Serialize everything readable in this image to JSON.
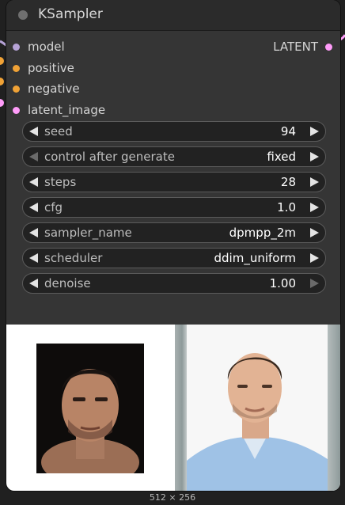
{
  "node": {
    "title": "KSampler",
    "inputs": [
      {
        "label": "model",
        "color": "#b6a3d6"
      },
      {
        "label": "positive",
        "color": "#f0a236"
      },
      {
        "label": "negative",
        "color": "#f0a236"
      },
      {
        "label": "latent_image",
        "color": "#ff9cf9"
      }
    ],
    "output": {
      "label": "LATENT",
      "color": "#ff9cf9"
    },
    "widgets": [
      {
        "label": "seed",
        "value": "94"
      },
      {
        "label": "control after generate",
        "value": "fixed"
      },
      {
        "label": "steps",
        "value": "28"
      },
      {
        "label": "cfg",
        "value": "1.0"
      },
      {
        "label": "sampler_name",
        "value": "dpmpp_2m"
      },
      {
        "label": "scheduler",
        "value": "ddim_uniform"
      },
      {
        "label": "denoise",
        "value": "1.00"
      }
    ]
  },
  "preview": {
    "size_label": "512 × 256",
    "images": [
      "face-portrait-dark-background",
      "man-blue-shirt-photo"
    ]
  },
  "colors": {
    "node_bg": "#353535",
    "title_bg": "#2b2b2b",
    "widget_bg": "#222222",
    "clip_orange": "#f0a236",
    "latent_pink": "#ff9cf9",
    "model_lavender": "#b6a3d6"
  }
}
